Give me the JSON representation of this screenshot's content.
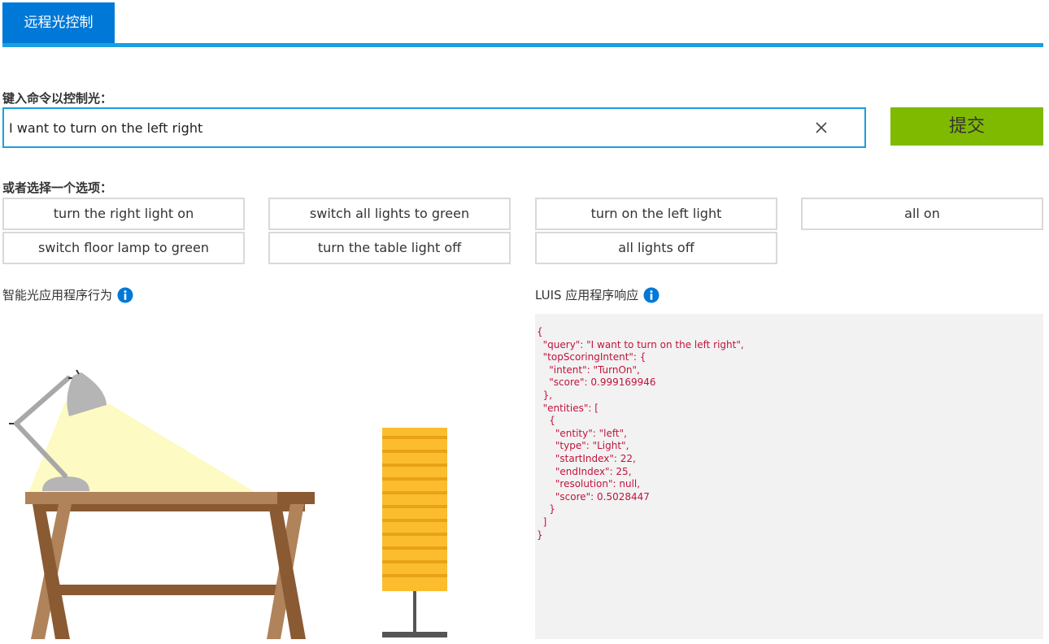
{
  "tab": {
    "label": "远程光控制"
  },
  "command": {
    "label": "键入命令以控制光：",
    "value": "I want to turn on the left right",
    "submit_label": "提交"
  },
  "options": {
    "label": "或者选择一个选项：",
    "items": [
      "turn the right light on",
      "switch all lights to green",
      "turn on the left light",
      "all on",
      "switch floor lamp to green",
      "turn the table light off",
      "all lights off"
    ]
  },
  "app_section": {
    "title": "智能光应用程序行为"
  },
  "luis_section": {
    "title": "LUIS 应用程序响应",
    "response": "{\n  \"query\": \"I want to turn on the left right\",\n  \"topScoringIntent\": {\n    \"intent\": \"TurnOn\",\n    \"score\": 0.999169946\n  },\n  \"entities\": [\n    {\n      \"entity\": \"left\",\n      \"type\": \"Light\",\n      \"startIndex\": 22,\n      \"endIndex\": 25,\n      \"resolution\": null,\n      \"score\": 0.5028447\n    }\n  ]\n}"
  },
  "colors": {
    "tab_blue": "#0078d7",
    "accent_blue": "#1a9fe0",
    "submit_green": "#7fba00",
    "json_text": "#c0143c",
    "panel_bg": "#f2f2f2",
    "lamp_shade": "#fbbd2e"
  },
  "icons": [
    "close-icon",
    "info-icon"
  ]
}
